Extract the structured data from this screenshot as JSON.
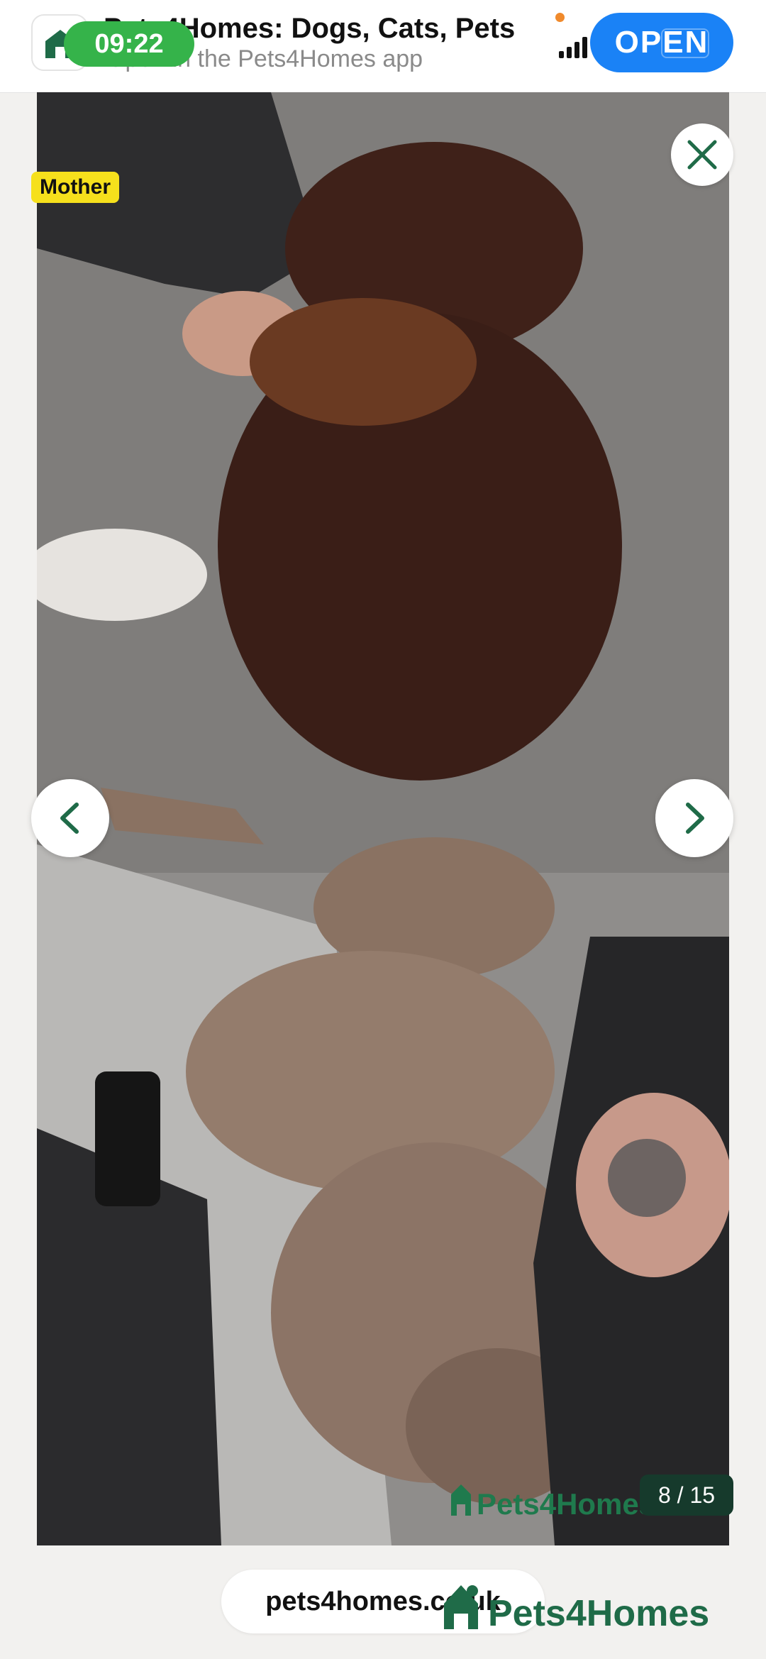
{
  "banner": {
    "clock": "09:22",
    "app_title": "Pets4Homes: Dogs, Cats, Pets",
    "app_subtitle": "Open in the Pets4Homes app",
    "open_label": "OPEN",
    "status_icons": [
      "cellular-signal-icon",
      "wifi-icon",
      "battery-icon"
    ]
  },
  "viewer": {
    "badge": "Mother",
    "counter": "8 / 15",
    "watermark": "Pets4Homes",
    "icons": [
      "close-icon",
      "chevron-left-icon",
      "chevron-right-icon"
    ]
  },
  "footer": {
    "url": "pets4homes.co.uk",
    "brand": "Pets4Homes"
  },
  "colors": {
    "brand_green": "#1f6b48",
    "badge_yellow": "#f6e01c",
    "open_blue": "#1a82f6",
    "clock_green": "#35b34a"
  }
}
